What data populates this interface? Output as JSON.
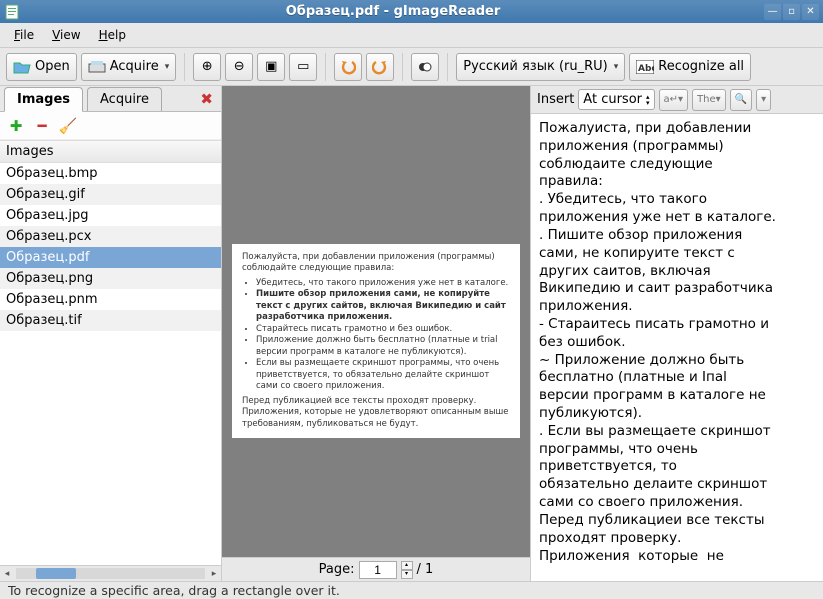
{
  "window": {
    "title": "Образец.pdf - gImageReader"
  },
  "menu": {
    "file": "File",
    "view": "View",
    "help": "Help"
  },
  "toolbar": {
    "open": "Open",
    "acquire": "Acquire",
    "language": "Русский язык (ru_RU)",
    "recognize_all": "Recognize all"
  },
  "tabs": {
    "images": "Images",
    "acquire": "Acquire"
  },
  "list": {
    "header": "Images",
    "items": [
      "Образец.bmp",
      "Образец.gif",
      "Образец.jpg",
      "Образец.pcx",
      "Образец.pdf",
      "Образец.png",
      "Образец.pnm",
      "Образец.tif"
    ],
    "selected_index": 4
  },
  "page_doc": {
    "intro": "Пожалуйста, при добавлении приложения (программы) соблюдайте следующие правила:",
    "b1": "Убедитесь, что такого приложения уже нет в каталоге.",
    "b2": "Пишите обзор приложения сами, не копируйте текст с других сайтов, включая Википедию и сайт разработчика приложения.",
    "b3": "Старайтесь писать грамотно и без ошибок.",
    "b4": "Приложение должно быть бесплатно (платные и trial версии программ в каталоге не публикуются).",
    "b5": "Если вы размещаете скриншот программы, что очень приветствуется, то обязательно делайте скриншот сами со своего приложения.",
    "outro": "Перед публикацией все тексты проходят проверку. Приложения, которые не удовлетворяют описанным выше требованиям, публиковаться не будут."
  },
  "pager": {
    "label": "Page:",
    "current": "1",
    "total": "/ 1"
  },
  "output": {
    "insert_label": "Insert",
    "insert_mode": "At cursor",
    "the_label": "The",
    "text": "Пожалуиста, при добавлении\nприложения (программы)\nсоблюдаите следующие\nправила:\n. Убедитесь, что такого\nприложения уже нет в каталоге.\n. Пишите обзор приложения\nсами, не копируите текст с\nдругих саитов, включая\nВикипедию и саит разработчика\nприложения.\n- Стараитесь писать грамотно и\nбез ошибок.\n~ Приложение должно быть\nбесплатно (платные и Iпаl\nверсии программ в каталоге не\nпубликуются).\n. Если вы размещаете скриншот\nпрограммы, что очень\nприветствуется, то\nобязательно делаите скриншот\nсами со своего приложения.\nПеред публикациеи все тексты\nпроходят проверку.\nПриложения  которые  не"
  },
  "status": {
    "text": "To recognize a specific area, drag a rectangle over it."
  }
}
